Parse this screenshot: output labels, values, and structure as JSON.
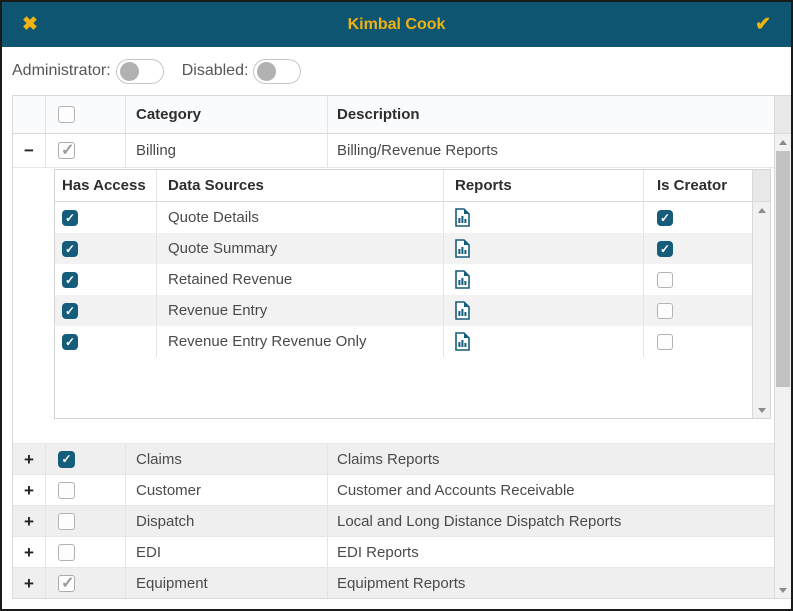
{
  "window": {
    "title": "Kimbal Cook",
    "close_icon": "✖",
    "confirm_icon": "✔"
  },
  "toggles": {
    "administrator": {
      "label": "Administrator:",
      "state": "off"
    },
    "disabled": {
      "label": "Disabled:",
      "state": "off"
    }
  },
  "grid": {
    "headers": {
      "category": "Category",
      "description": "Description"
    },
    "select_all_checkbox": "unchecked",
    "rows": [
      {
        "category": "Billing",
        "description": "Billing/Revenue Reports",
        "checkbox": "gray-check",
        "expanded": true
      },
      {
        "category": "Claims",
        "description": "Claims Reports",
        "checkbox": "checked",
        "expanded": false
      },
      {
        "category": "Customer",
        "description": "Customer and Accounts Receivable",
        "checkbox": "unchecked",
        "expanded": false
      },
      {
        "category": "Dispatch",
        "description": "Local and Long Distance Dispatch Reports",
        "checkbox": "unchecked",
        "expanded": false
      },
      {
        "category": "EDI",
        "description": "EDI Reports",
        "checkbox": "unchecked",
        "expanded": false
      },
      {
        "category": "Equipment",
        "description": "Equipment Reports",
        "checkbox": "gray-check",
        "expanded": false
      }
    ]
  },
  "detail_grid": {
    "headers": {
      "has_access": "Has Access",
      "data_sources": "Data Sources",
      "reports": "Reports",
      "is_creator": "Is Creator"
    },
    "rows": [
      {
        "data_source": "Quote Details",
        "has_access": "checked",
        "report": "report-icon",
        "is_creator": "checked"
      },
      {
        "data_source": "Quote Summary",
        "has_access": "checked",
        "report": "report-icon",
        "is_creator": "checked"
      },
      {
        "data_source": "Retained Revenue",
        "has_access": "checked",
        "report": "report-icon",
        "is_creator": "unchecked"
      },
      {
        "data_source": "Revenue Entry",
        "has_access": "checked",
        "report": "report-icon",
        "is_creator": "unchecked"
      },
      {
        "data_source": "Revenue Entry Revenue Only",
        "has_access": "checked",
        "report": "report-icon",
        "is_creator": "unchecked"
      }
    ]
  },
  "expand_symbols": {
    "expanded": "−",
    "collapsed": "+"
  },
  "colors": {
    "titlebar_bg": "#0e5572",
    "accent_yellow": "#eeb211",
    "checkbox_teal": "#155d7a",
    "row_stripe": "#efefef",
    "border": "#d9d9d9"
  }
}
